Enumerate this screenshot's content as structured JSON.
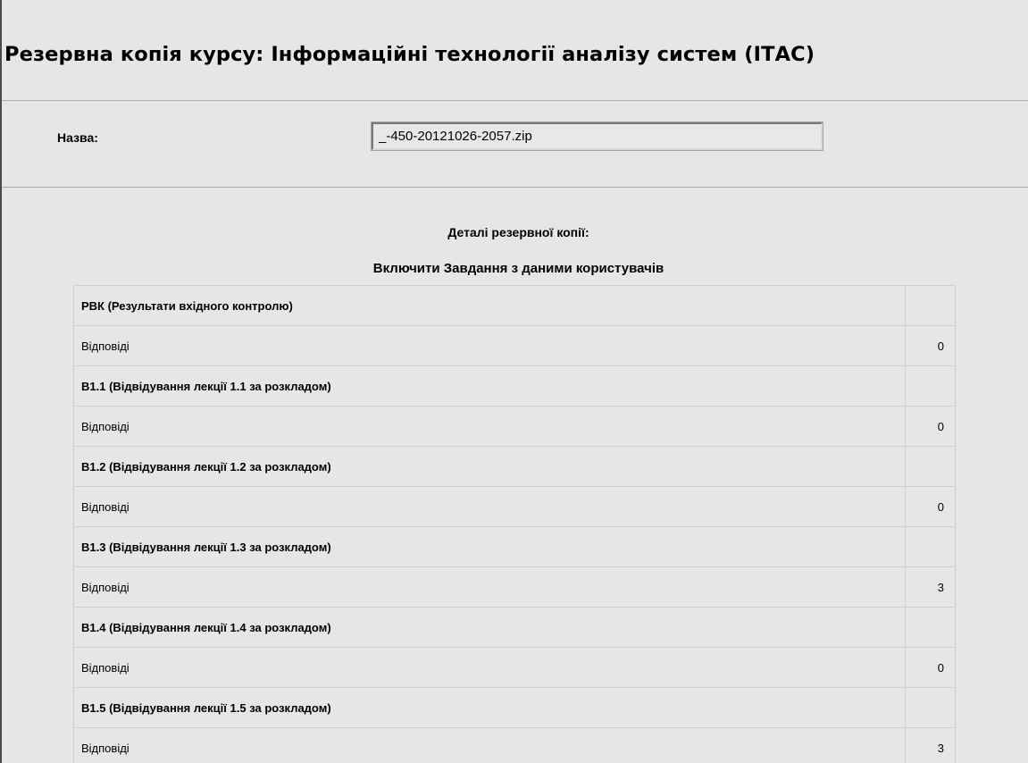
{
  "page": {
    "title": "Резервна копія курсу: Інформаційні технології аналізу систем (ІТАС)"
  },
  "name_field": {
    "label": "Назва:",
    "value": "_-450-20121026-2057.zip"
  },
  "details": {
    "title": "Деталі резервної копії:",
    "subtitle": "Включити Завдання з даними користувачів",
    "rows": [
      {
        "type": "activity",
        "name": "РВК (Результати вхідного контролю)",
        "count": ""
      },
      {
        "type": "item",
        "name": "Відповіді",
        "count": "0"
      },
      {
        "type": "activity",
        "name": "В1.1 (Відвідування лекції 1.1 за розкладом)",
        "count": ""
      },
      {
        "type": "item",
        "name": "Відповіді",
        "count": "0"
      },
      {
        "type": "activity",
        "name": "В1.2 (Відвідування лекції 1.2 за розкладом)",
        "count": ""
      },
      {
        "type": "item",
        "name": "Відповіді",
        "count": "0"
      },
      {
        "type": "activity",
        "name": "В1.3 (Відвідування лекції 1.3 за розкладом)",
        "count": ""
      },
      {
        "type": "item",
        "name": "Відповіді",
        "count": "3"
      },
      {
        "type": "activity",
        "name": "В1.4 (Відвідування лекції 1.4 за розкладом)",
        "count": ""
      },
      {
        "type": "item",
        "name": "Відповіді",
        "count": "0"
      },
      {
        "type": "activity",
        "name": "В1.5 (Відвідування лекції 1.5 за розкладом)",
        "count": ""
      },
      {
        "type": "item",
        "name": "Відповіді",
        "count": "3"
      }
    ]
  }
}
